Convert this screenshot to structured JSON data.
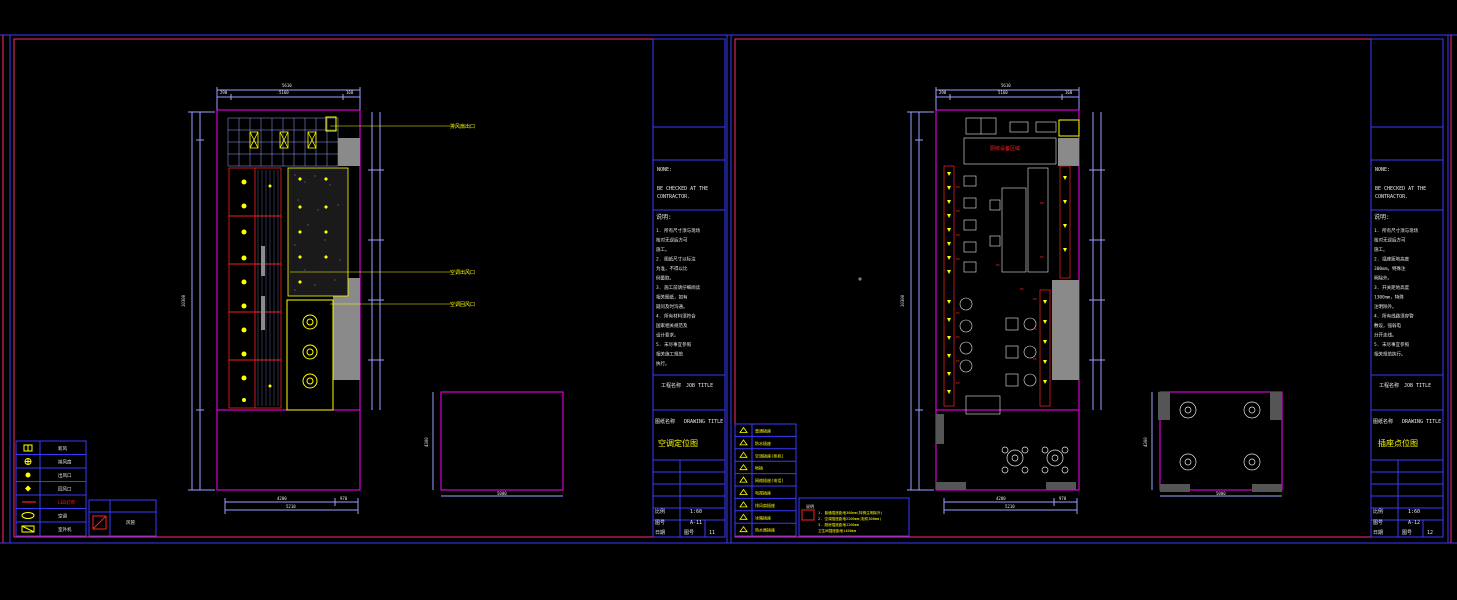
{
  "colors": {
    "background": "#000000",
    "frame_blue": "#3a3aff",
    "frame_magenta": "#ff2a6d",
    "wall": "#ff00ff",
    "dim": "#9aa0ff",
    "yellow": "#ffff00",
    "red": "#ff2020",
    "white": "#e8e8e8",
    "gray_fill": "#8a8a8a"
  },
  "sheet_left": {
    "title_block": {
      "note_label": "NONE:",
      "note_text_1": "BE CHECKED AT THE",
      "note_text_2": "CONTRACTOR.",
      "explain_label": "说明:",
      "explain_lines": [
        "1. 所有尺寸须与现场",
        "   核对无误后方可",
        "   施工。",
        "2. 图纸尺寸以标注",
        "   为准，不得以比",
        "   例量取。",
        "3. 施工前请仔细阅读",
        "   相关图纸，如有",
        "   疑问及时沟通。",
        "4. 所有材料须符合",
        "   国家相关规范及",
        "   设计要求。",
        "5. 未尽事宜参照",
        "   相关施工规范",
        "   执行。"
      ],
      "project_label": "工程名称",
      "job_title": "JOB TITLE",
      "drawing_label": "图纸名称",
      "drawing_title_en": "DRAWING TITLE",
      "drawing_title": "空调定位图",
      "scale_label": "比例",
      "scale_value": "1:60",
      "drawing_no_label": "图号",
      "drawing_no_value": "A-11",
      "date_label": "日期",
      "sheet_label": "图号",
      "sheet_value": "11"
    },
    "dims": {
      "top_total": "5610",
      "top_a": "290",
      "top_b": "5160",
      "top_c": "160",
      "bottom_a": "4200",
      "bottom_b": "970",
      "bottom_total": "5210",
      "left_total": "10300",
      "box_dim_v": "4300",
      "box_dim_h": "5000"
    },
    "callouts": [
      "排风扇出口",
      "空调出风口",
      "空调回风口"
    ],
    "legend": [
      {
        "sym": "grid-sym",
        "label": "新风"
      },
      {
        "sym": "fan-sym",
        "label": "排风扇"
      },
      {
        "sym": "diffuser-sym",
        "label": "出风口"
      },
      {
        "sym": "diamond-sym",
        "label": "回风口"
      },
      {
        "sym": "line-sym",
        "label": "LED灯带"
      },
      {
        "sym": "ac-sym",
        "label": "空调"
      },
      {
        "sym": "unit-sym",
        "label": "室外机"
      }
    ],
    "legend_small": {
      "label": "风管"
    }
  },
  "sheet_right": {
    "title_block": {
      "note_label": "NONE:",
      "note_text_1": "BE CHECKED AT THE",
      "note_text_2": "CONTRACTOR.",
      "explain_label": "说明:",
      "explain_lines": [
        "1. 所有尺寸须与现场",
        "   核对无误后方可",
        "   施工。",
        "2. 插座距地高度",
        "   300mm，特殊注",
        "   明除外。",
        "3. 开关距地高度",
        "   1300mm，特殊",
        "   注明除外。",
        "4. 所有线路须穿管",
        "   敷设，强弱电",
        "   分开走线。",
        "5. 未尽事宜参照",
        "   相关规范执行。"
      ],
      "project_label": "工程名称",
      "job_title": "JOB TITLE",
      "drawing_label": "图纸名称",
      "drawing_title_en": "DRAWING TITLE",
      "drawing_title": "插座点位图",
      "scale_label": "比例",
      "scale_value": "1:60",
      "drawing_no_label": "图号",
      "drawing_no_value": "A-12",
      "date_label": "日期",
      "sheet_label": "图号",
      "sheet_value": "12"
    },
    "dims": {
      "top_total": "5610",
      "top_a": "290",
      "top_b": "5160",
      "top_c": "160",
      "bottom_a": "4200",
      "bottom_b": "970",
      "bottom_total": "5210",
      "left_total": "10300",
      "box_dim_v": "4300",
      "box_dim_h": "5000"
    },
    "kitchen_label": "厨房设备区域",
    "legend": [
      {
        "label": "普通插座"
      },
      {
        "label": "防水插座"
      },
      {
        "label": "空调插座(柜机)"
      },
      {
        "label": "地插"
      },
      {
        "label": "网络插座(电话)"
      },
      {
        "label": "电视插座"
      },
      {
        "label": "排风扇插座"
      },
      {
        "label": "冰箱插座"
      },
      {
        "label": "热水器插座"
      }
    ],
    "notes": [
      "1. 普通插座距地300mm(特殊注明除外)",
      "2. 空调插座距地2200mm(柜机300mm)",
      "3. 厨房插座距地1200mm",
      "   卫生间插座距地1400mm"
    ],
    "notes_title": "说明"
  }
}
